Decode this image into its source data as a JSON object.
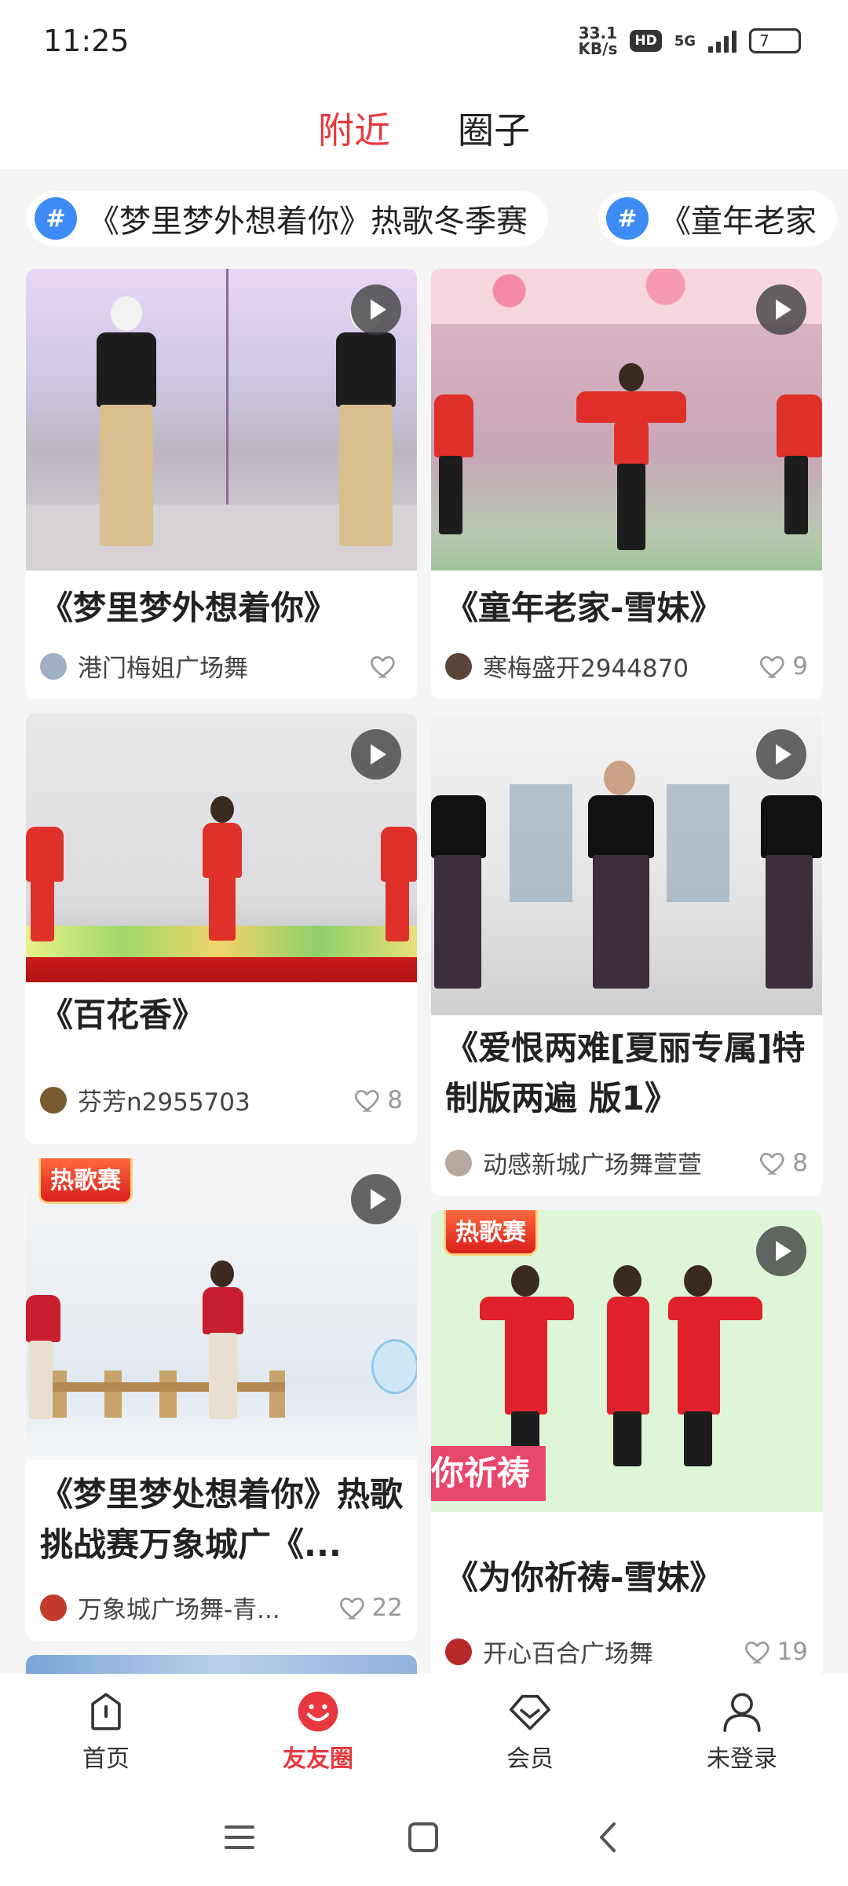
{
  "status_bar": {
    "time": "11:25",
    "speed_value": "33.1",
    "speed_unit": "KB/s",
    "hd": "HD",
    "network": "5G",
    "battery": "7"
  },
  "header": {
    "tabs": [
      {
        "label": "附近",
        "active": true
      },
      {
        "label": "圈子",
        "active": false
      }
    ]
  },
  "topics": [
    {
      "icon": "#",
      "label": "《梦里梦外想着你》热歌冬季赛"
    },
    {
      "icon": "#",
      "label": "《童年老家"
    }
  ],
  "cards": [
    {
      "title": "《梦里梦外想着你》",
      "author": "港门梅姐广场舞",
      "likes": "",
      "badge": ""
    },
    {
      "title": "《童年老家-雪妹》",
      "author": "寒梅盛开2944870",
      "likes": "9",
      "badge": ""
    },
    {
      "title": "《百花香》",
      "author": "芬芳n2955703",
      "likes": "8",
      "badge": ""
    },
    {
      "title": "《爱恨两难[夏丽专属]特制版两遍 版1》",
      "author": "动感新城广场舞萱萱",
      "likes": "8",
      "badge": ""
    },
    {
      "title": "《梦里梦处想着你》热歌挑战赛万象城广《...",
      "author": "万象城广场舞-青...",
      "likes": "22",
      "badge": "热歌赛"
    },
    {
      "title": "《为你祈祷-雪妹》",
      "author": "开心百合广场舞",
      "likes": "19",
      "badge": "热歌赛",
      "overlay_text": "你祈祷"
    }
  ],
  "bottom_nav": [
    {
      "label": "首页",
      "icon": "home-icon",
      "active": false
    },
    {
      "label": "友友圈",
      "icon": "smiley-icon",
      "active": true
    },
    {
      "label": "会员",
      "icon": "diamond-icon",
      "active": false
    },
    {
      "label": "未登录",
      "icon": "person-icon",
      "active": false
    }
  ],
  "colors": {
    "accent": "#e8383d",
    "topic_icon": "#3d8bf5",
    "background": "#f5f5f5"
  }
}
